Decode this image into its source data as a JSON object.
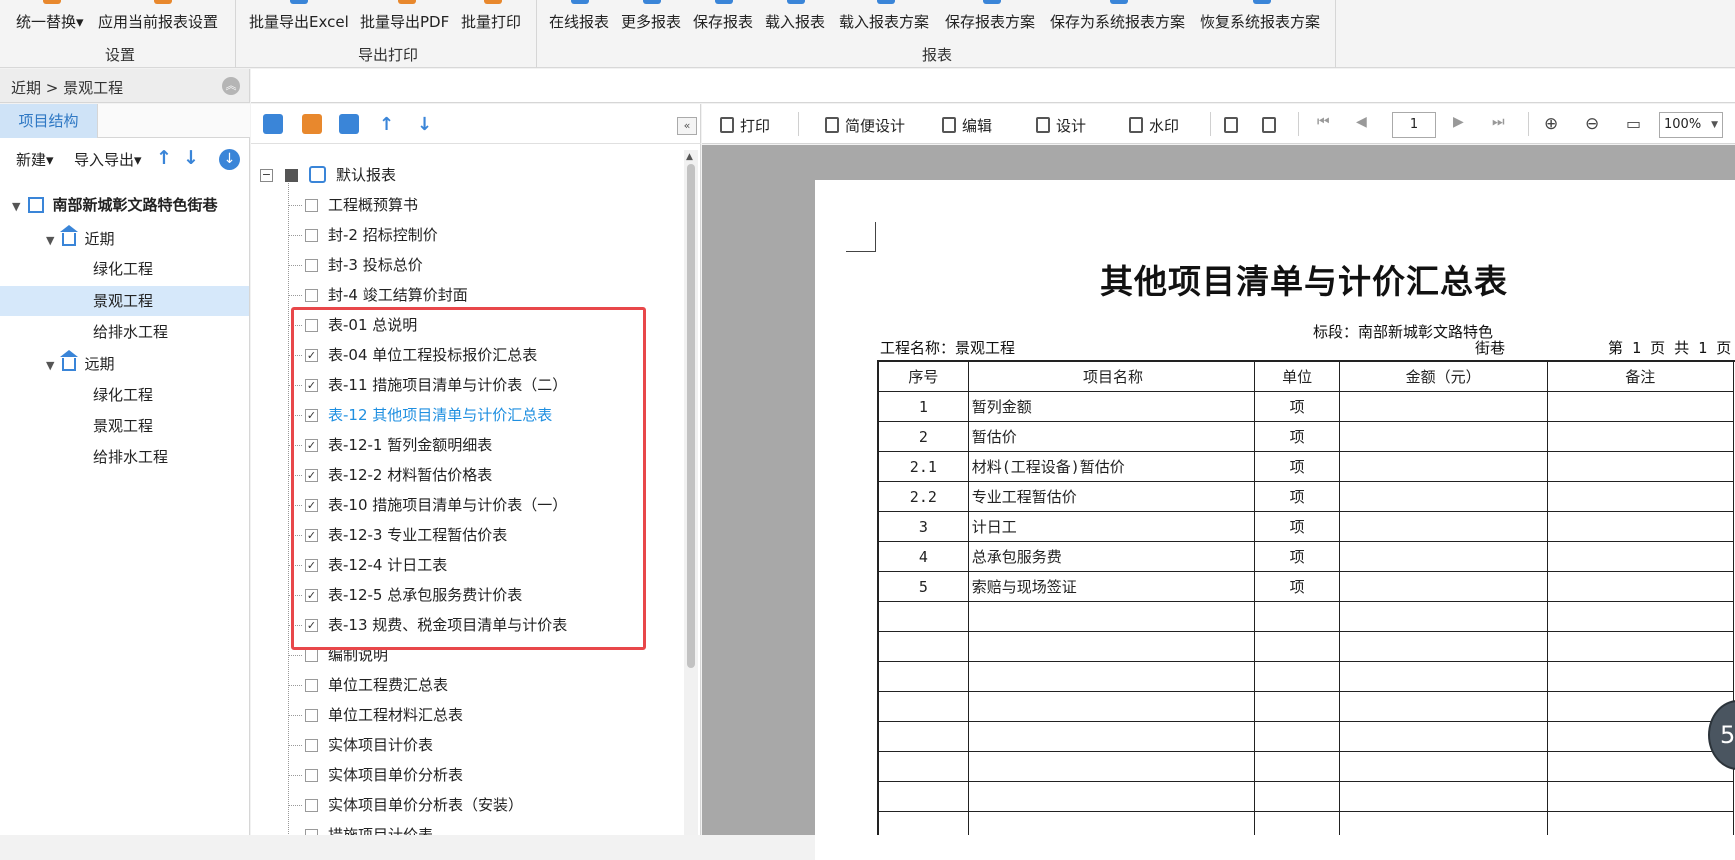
{
  "ribbon": {
    "groups": [
      {
        "label": "设置",
        "buttons": [
          "统一替换▾",
          "应用当前报表设置"
        ]
      },
      {
        "label": "导出打印",
        "buttons": [
          "批量导出Excel",
          "批量导出PDF",
          "批量打印"
        ]
      },
      {
        "label": "报表",
        "buttons": [
          "在线报表",
          "更多报表",
          "保存报表",
          "载入报表",
          "载入报表方案",
          "保存报表方案",
          "保存为系统报表方案",
          "恢复系统报表方案"
        ]
      }
    ]
  },
  "breadcrumb": "近期 > 景观工程",
  "left_panel": {
    "tab": "项目结构",
    "toolbar": {
      "new": "新建▾",
      "import_export": "导入导出▾"
    },
    "tree": {
      "root": "南部新城彰文路特色街巷",
      "groups": [
        {
          "name": "近期",
          "items": [
            "绿化工程",
            "景观工程",
            "给排水工程"
          ]
        },
        {
          "name": "远期",
          "items": [
            "绿化工程",
            "景观工程",
            "给排水工程"
          ]
        }
      ],
      "selected": "景观工程"
    }
  },
  "report_tree": {
    "root": "默认报表",
    "items": [
      {
        "label": "工程概预算书",
        "checked": false
      },
      {
        "label": "封-2 招标控制价",
        "checked": false
      },
      {
        "label": "封-3 投标总价",
        "checked": false
      },
      {
        "label": "封-4 竣工结算价封面",
        "checked": false
      },
      {
        "label": "表-01 总说明",
        "checked": false
      },
      {
        "label": "表-04 单位工程投标报价汇总表",
        "checked": true
      },
      {
        "label": "表-11 措施项目清单与计价表（二）",
        "checked": true
      },
      {
        "label": "表-12 其他项目清单与计价汇总表",
        "checked": true,
        "active": true
      },
      {
        "label": "表-12-1 暂列金额明细表",
        "checked": true
      },
      {
        "label": "表-12-2 材料暂估价格表",
        "checked": true
      },
      {
        "label": "表-10 措施项目清单与计价表（一）",
        "checked": true
      },
      {
        "label": "表-12-3 专业工程暂估价表",
        "checked": true
      },
      {
        "label": "表-12-4 计日工表",
        "checked": true
      },
      {
        "label": "表-12-5 总承包服务费计价表",
        "checked": true
      },
      {
        "label": "表-13 规费、税金项目清单与计价表",
        "checked": true
      },
      {
        "label": "编制说明",
        "checked": false
      },
      {
        "label": "单位工程费汇总表",
        "checked": false
      },
      {
        "label": "单位工程材料汇总表",
        "checked": false
      },
      {
        "label": "实体项目计价表",
        "checked": false
      },
      {
        "label": "实体项目单价分析表",
        "checked": false
      },
      {
        "label": "实体项目单价分析表（安装）",
        "checked": false
      },
      {
        "label": "措施项目计价表",
        "checked": false
      }
    ]
  },
  "preview_toolbar": {
    "print": "打印",
    "simple_design": "简便设计",
    "edit": "编辑",
    "design": "设计",
    "watermark": "水印",
    "page": "1",
    "zoom": "100%"
  },
  "report": {
    "title": "其他项目清单与计价汇总表",
    "project": "工程名称：景观工程",
    "section_line1": "标段：南部新城彰文路特色",
    "section_line2": "街巷",
    "page_info": "第 1 页  共 1 页",
    "headers": [
      "序号",
      "项目名称",
      "单位",
      "金额（元）",
      "备注"
    ],
    "rows": [
      [
        "1",
        "暂列金额",
        "项",
        "",
        ""
      ],
      [
        "2",
        "暂估价",
        "项",
        "",
        ""
      ],
      [
        "2.1",
        "材料(工程设备)暂估价",
        "项",
        "",
        ""
      ],
      [
        "2.2",
        "专业工程暂估价",
        "项",
        "",
        ""
      ],
      [
        "3",
        "计日工",
        "项",
        "",
        ""
      ],
      [
        "4",
        "总承包服务费",
        "项",
        "",
        ""
      ],
      [
        "5",
        "索赔与现场签证",
        "项",
        "",
        ""
      ],
      [
        "",
        "",
        "",
        "",
        ""
      ],
      [
        "",
        "",
        "",
        "",
        ""
      ],
      [
        "",
        "",
        "",
        "",
        ""
      ],
      [
        "",
        "",
        "",
        "",
        ""
      ],
      [
        "",
        "",
        "",
        "",
        ""
      ],
      [
        "",
        "",
        "",
        "",
        ""
      ],
      [
        "",
        "",
        "",
        "",
        ""
      ],
      [
        "",
        "",
        "",
        "",
        ""
      ]
    ],
    "badge": "5"
  }
}
